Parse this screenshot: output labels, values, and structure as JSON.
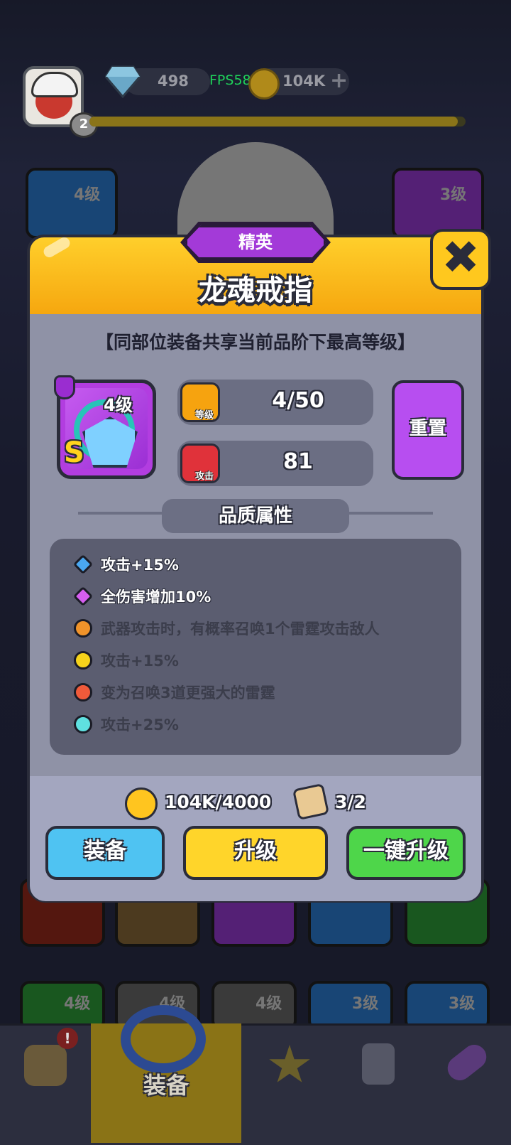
{
  "top_bar": {
    "player_level": "2",
    "diamonds": "498",
    "fps": "FPS58",
    "coins": "104K",
    "add_symbol": "+",
    "xp_progress": 0.98
  },
  "background_cards": {
    "upper_left_level": "4级",
    "upper_right_level": "3级",
    "row_levels": [
      "4级",
      "4级",
      "4级",
      "3级",
      "3级"
    ]
  },
  "modal": {
    "rarity": "精英",
    "title": "龙魂戒指",
    "close_symbol": "✖",
    "subtitle": "【同部位装备共享当前品阶下最高等级】",
    "item": {
      "grade": "S",
      "level": "4级"
    },
    "stats": [
      {
        "icon_label": "等级",
        "value": "4/50",
        "icon": "crown-icon",
        "color": "#f6a30f"
      },
      {
        "icon_label": "攻击",
        "value": "81",
        "icon": "sword-icon",
        "color": "#e0323a"
      }
    ],
    "reset_label": "重置",
    "quality_section_title": "品质属性",
    "attributes": [
      {
        "text": "攻击+15%",
        "unlocked": true,
        "icon": "blue-diamond-icon",
        "color": "#4aa7f0"
      },
      {
        "text": "全伤害增加10%",
        "unlocked": true,
        "icon": "purple-diamond-icon",
        "color": "#d65ef0"
      },
      {
        "text": "武器攻击时，有概率召唤1个雷霆攻击敌人",
        "unlocked": false,
        "icon": "lock-icon",
        "color": "#f0932a"
      },
      {
        "text": "攻击+15%",
        "unlocked": false,
        "icon": "lock-icon",
        "color": "#f6d31b"
      },
      {
        "text": "变为召唤3道更强大的雷霆",
        "unlocked": false,
        "icon": "lock-icon",
        "color": "#f05a3a"
      },
      {
        "text": "攻击+25%",
        "unlocked": false,
        "icon": "lock-icon",
        "color": "#5fe0e0"
      }
    ],
    "costs": {
      "coins": "104K/4000",
      "scrolls": "3/2"
    },
    "buttons": {
      "equip": "装备",
      "upgrade": "升级",
      "one_click_upgrade": "一键升级"
    }
  },
  "bottom_nav": {
    "selected_label": "装备",
    "alert_badge": "!"
  }
}
